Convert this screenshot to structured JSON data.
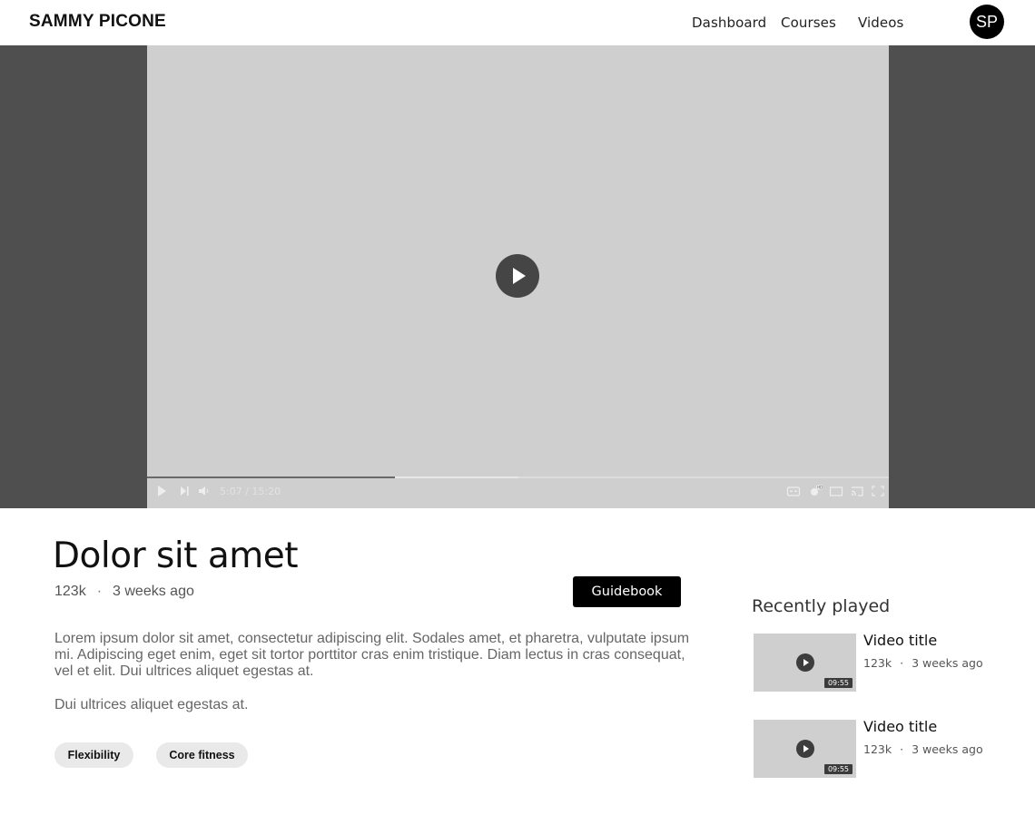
{
  "header": {
    "brand": "SAMMY PICONE",
    "nav": [
      "Dashboard",
      "Courses",
      "Videos"
    ],
    "avatar_initials": "SP"
  },
  "player": {
    "current_time": "5:07",
    "total_time": "15:20",
    "time_separator": "/",
    "progress_played": 0.334,
    "progress_buffered": 0.5,
    "icons": {
      "play": "play-icon",
      "next": "skip-next-icon",
      "volume": "volume-icon",
      "captions": "captions-icon",
      "settings": "settings-hd-icon",
      "theater": "theater-mode-icon",
      "cast": "cast-icon",
      "fullscreen": "fullscreen-icon"
    }
  },
  "video": {
    "title": "Dolor sit amet",
    "views": "123k",
    "separator": "·",
    "posted": "3 weeks ago",
    "guidebook_label": "Guidebook",
    "description": "Lorem ipsum dolor sit amet, consectetur adipiscing elit. Sodales amet, et pharetra, vulputate ipsum mi. Adipiscing eget enim, eget sit tortor porttitor cras enim tristique. Diam lectus in cras consequat, vel et elit. Dui ultrices aliquet egestas at.",
    "description_2": "Dui ultrices aliquet egestas at.",
    "tags": [
      "Flexibility",
      "Core fitness"
    ]
  },
  "recent": {
    "heading": "Recently played",
    "items": [
      {
        "title": "Video title",
        "views": "123k",
        "separator": "·",
        "posted": "3 weeks ago",
        "duration": "09:55"
      },
      {
        "title": "Video title",
        "views": "123k",
        "separator": "·",
        "posted": "3 weeks ago",
        "duration": "09:55"
      }
    ]
  },
  "colors": {
    "stage_bg": "#4f4f4f",
    "player_bg": "#cfcfcf",
    "accent": "#000000",
    "tag_bg": "#e9e9e9"
  }
}
